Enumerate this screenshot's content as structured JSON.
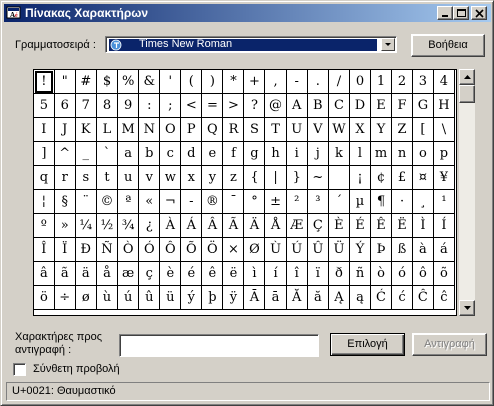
{
  "window": {
    "title": "Πίνακας Χαρακτήρων"
  },
  "font_row": {
    "label": "Γραμματοσειρά :",
    "selected_font": "Times New Roman",
    "help_button": "Βοήθεια"
  },
  "grid": {
    "rows": [
      [
        "!",
        "\"",
        "#",
        "$",
        "%",
        "&",
        "'",
        "(",
        ")",
        "*",
        "+",
        ",",
        "-",
        ".",
        "/",
        "0",
        "1",
        "2",
        "3",
        "4"
      ],
      [
        "5",
        "6",
        "7",
        "8",
        "9",
        ":",
        ";",
        "<",
        "=",
        ">",
        "?",
        "@",
        "A",
        "B",
        "C",
        "D",
        "E",
        "F",
        "G",
        "H"
      ],
      [
        "I",
        "J",
        "K",
        "L",
        "M",
        "N",
        "O",
        "P",
        "Q",
        "R",
        "S",
        "T",
        "U",
        "V",
        "W",
        "X",
        "Y",
        "Z",
        "[",
        "\\"
      ],
      [
        "]",
        "^",
        "_",
        "`",
        "a",
        "b",
        "c",
        "d",
        "e",
        "f",
        "g",
        "h",
        "i",
        "j",
        "k",
        "l",
        "m",
        "n",
        "o",
        "p"
      ],
      [
        "q",
        "r",
        "s",
        "t",
        "u",
        "v",
        "w",
        "x",
        "y",
        "z",
        "{",
        "|",
        "}",
        "~",
        " ",
        "¡",
        "¢",
        "£",
        "¤",
        "¥"
      ],
      [
        "¦",
        "§",
        "¨",
        "©",
        "ª",
        "«",
        "¬",
        "-",
        "®",
        "¯",
        "°",
        "±",
        "²",
        "³",
        "´",
        "µ",
        "¶",
        "·",
        "¸",
        "¹"
      ],
      [
        "º",
        "»",
        "¼",
        "½",
        "¾",
        "¿",
        "À",
        "Á",
        "Â",
        "Ã",
        "Ä",
        "Å",
        "Æ",
        "Ç",
        "È",
        "É",
        "Ê",
        "Ë",
        "Ì",
        "Í"
      ],
      [
        "Î",
        "Ï",
        "Ð",
        "Ñ",
        "Ò",
        "Ó",
        "Ô",
        "Õ",
        "Ö",
        "×",
        "Ø",
        "Ù",
        "Ú",
        "Û",
        "Ü",
        "Ý",
        "Þ",
        "ß",
        "à",
        "á"
      ],
      [
        "â",
        "ã",
        "ä",
        "å",
        "æ",
        "ç",
        "è",
        "é",
        "ê",
        "ë",
        "ì",
        "í",
        "î",
        "ï",
        "ð",
        "ñ",
        "ò",
        "ó",
        "ô",
        "õ"
      ],
      [
        "ö",
        "÷",
        "ø",
        "ù",
        "ú",
        "û",
        "ü",
        "ý",
        "þ",
        "ÿ",
        "Ā",
        "ā",
        "Ă",
        "ă",
        "Ą",
        "ą",
        "Ć",
        "ć",
        "Ĉ",
        "ĉ"
      ]
    ]
  },
  "copy_row": {
    "label_line1": "Χαρακτήρες προς",
    "label_line2": "αντιγραφή :",
    "input_value": "",
    "select_button": "Επιλογή",
    "copy_button": "Αντιγραφή"
  },
  "advanced": {
    "label": "Σύνθετη προβολή",
    "checked": false
  },
  "status": {
    "text": "U+0021: Θαυμαστικό"
  }
}
